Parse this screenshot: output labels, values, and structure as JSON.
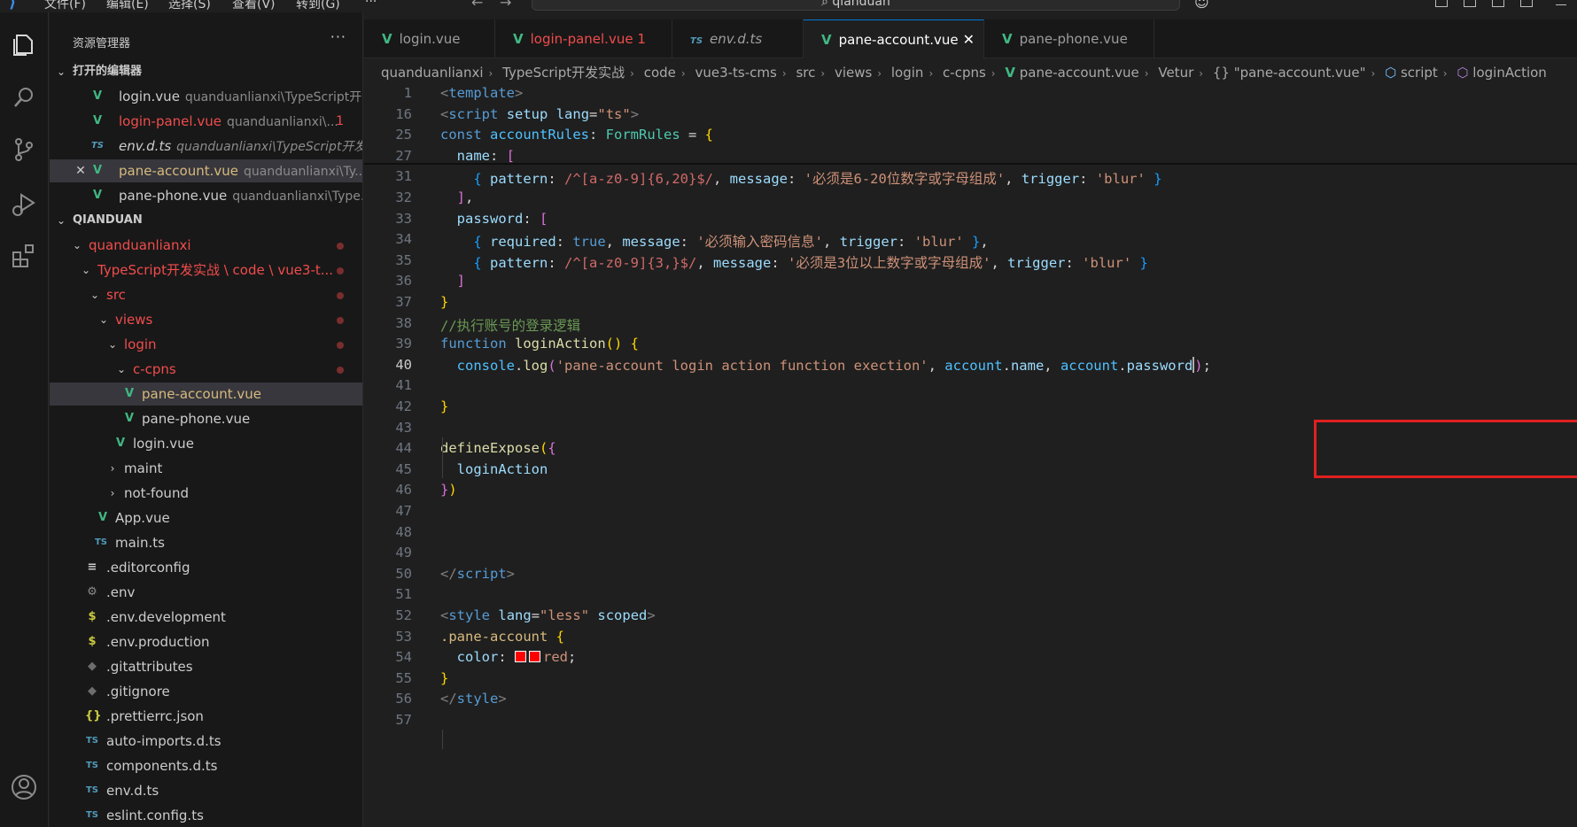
{
  "titlebar": {
    "menu": [
      "文件(F)",
      "编辑(E)",
      "选择(S)",
      "查看(V)",
      "转到(G)"
    ],
    "more": "···",
    "search_text": "qianduan"
  },
  "activity": {
    "icons": [
      "explorer-icon",
      "search-icon",
      "source-control-icon",
      "run-debug-icon",
      "extensions-icon",
      "account-icon"
    ]
  },
  "sidebar": {
    "title": "资源管理器",
    "more": "···",
    "open_editors_label": "打开的编辑器",
    "open_editors": [
      {
        "name": "login.vue",
        "path": "quanduanlianxi\\TypeScript开...",
        "icon": "vue"
      },
      {
        "name": "login-panel.vue",
        "path": "quanduanlianxi\\...",
        "icon": "vue",
        "badge": "1"
      },
      {
        "name": "env.d.ts",
        "path": "quanduanlianxi\\TypeScript开发...",
        "icon": "ts"
      },
      {
        "name": "pane-account.vue",
        "path": "quanduanlianxi\\Ty...",
        "icon": "vue",
        "close": "✕"
      },
      {
        "name": "pane-phone.vue",
        "path": "quanduanlianxi\\Type...",
        "icon": "vue"
      }
    ],
    "workspace_label": "QIANDUAN",
    "tree": [
      {
        "name": "quanduanlianxi",
        "type": "folder"
      },
      {
        "name": "TypeScript开发实战 \\ code \\ vue3-t...",
        "type": "folder"
      },
      {
        "name": "src",
        "type": "folder"
      },
      {
        "name": "views",
        "type": "folder"
      },
      {
        "name": "login",
        "type": "folder"
      },
      {
        "name": "c-cpns",
        "type": "folder"
      },
      {
        "name": "pane-account.vue",
        "type": "vue"
      },
      {
        "name": "pane-phone.vue",
        "type": "vue"
      },
      {
        "name": "login.vue",
        "type": "vue"
      },
      {
        "name": "maint",
        "type": "folder-closed"
      },
      {
        "name": "not-found",
        "type": "folder-closed"
      },
      {
        "name": "App.vue",
        "type": "vue"
      },
      {
        "name": "main.ts",
        "type": "ts"
      },
      {
        "name": ".editorconfig",
        "type": "lines"
      },
      {
        "name": ".env",
        "type": "gear"
      },
      {
        "name": ".env.development",
        "type": "dollar"
      },
      {
        "name": ".env.production",
        "type": "dollar"
      },
      {
        "name": ".gitattributes",
        "type": "git"
      },
      {
        "name": ".gitignore",
        "type": "git"
      },
      {
        "name": ".prettierrc.json",
        "type": "braces"
      },
      {
        "name": "auto-imports.d.ts",
        "type": "ts"
      },
      {
        "name": "components.d.ts",
        "type": "ts"
      },
      {
        "name": "env.d.ts",
        "type": "ts"
      },
      {
        "name": "eslint.config.ts",
        "type": "ts"
      }
    ]
  },
  "tabs": [
    {
      "label": "login.vue",
      "icon": "vue"
    },
    {
      "label": "login-panel.vue",
      "badge": "1",
      "icon": "vue"
    },
    {
      "label": "env.d.ts",
      "icon": "ts"
    },
    {
      "label": "pane-account.vue",
      "icon": "vue",
      "active": true
    },
    {
      "label": "pane-phone.vue",
      "icon": "vue"
    }
  ],
  "tab_close": "✕",
  "breadcrumb": [
    "quanduanlianxi",
    "TypeScript开发实战",
    "code",
    "vue3-ts-cms",
    "src",
    "views",
    "login",
    "c-cpns",
    "pane-account.vue",
    "Vetur",
    "{} \"pane-account.vue\"",
    "script",
    "loginAction"
  ],
  "editor": {
    "current_line": "40",
    "lines": [
      {
        "n": "1",
        "html": "<span class='t'>&lt;</span><span class='tg'>template</span><span class='t'>&gt;</span>"
      },
      {
        "n": "16",
        "html": "<span class='t'>&lt;</span><span class='tg'>script</span> <span class='at'>setup</span> <span class='at'>lang</span>=<span class='s'>\"ts\"</span><span class='t'>&gt;</span>"
      },
      {
        "n": "25",
        "html": "<span class='k'>const</span> <span class='v'>accountRules</span>: <span class='ty'>FormRules</span> = <span class='br1'>{</span>"
      },
      {
        "n": "27",
        "html": "  <span class='p'>name</span>: <span class='br2'>[</span>"
      },
      {
        "n": "31",
        "html": "    <span class='br3'>{</span> <span class='p'>pattern</span>: <span class='rx'>/^[a-z0-9]{6,20}$/</span>, <span class='p'>message</span>: <span class='s'>'必须是6-20位数字或字母组成'</span>, <span class='p'>trigger</span>: <span class='s'>'blur'</span> <span class='br3'>}</span>"
      },
      {
        "n": "32",
        "html": "  <span class='br2'>]</span>,"
      },
      {
        "n": "33",
        "html": "  <span class='p'>password</span>: <span class='br2'>[</span>"
      },
      {
        "n": "34",
        "html": "    <span class='br3'>{</span> <span class='p'>required</span>: <span class='k'>true</span>, <span class='p'>message</span>: <span class='s'>'必须输入密码信息'</span>, <span class='p'>trigger</span>: <span class='s'>'blur'</span> <span class='br3'>}</span>,"
      },
      {
        "n": "35",
        "html": "    <span class='br3'>{</span> <span class='p'>pattern</span>: <span class='rx'>/^[a-z0-9]{3,}$/</span>, <span class='p'>message</span>: <span class='s'>'必须是3位以上数字或字母组成'</span>, <span class='p'>trigger</span>: <span class='s'>'blur'</span> <span class='br3'>}</span>"
      },
      {
        "n": "36",
        "html": "  <span class='br2'>]</span>"
      },
      {
        "n": "37",
        "html": "<span class='br1'>}</span>"
      },
      {
        "n": "38",
        "html": "<span class='c'>//执行账号的登录逻辑</span>"
      },
      {
        "n": "39",
        "html": "<span class='k'>function</span> <span class='f'>loginAction</span><span class='br1'>()</span> <span class='br1'>{</span>"
      },
      {
        "n": "40",
        "html": "  <span class='v'>console</span>.<span class='f'>log</span><span class='br2'>(</span><span class='s'>'pane-account login action function exection'</span>, <span class='v'>account</span>.<span class='p'>name</span>, <span class='v'>account</span>.<span class='p'>password</span><span class='cursor'></span><span class='br2'>)</span>;"
      },
      {
        "n": "41",
        "html": ""
      },
      {
        "n": "42",
        "html": "<span class='br1'>}</span>"
      },
      {
        "n": "43",
        "html": ""
      },
      {
        "n": "44",
        "html": "<span class='f'>defineExpose</span><span class='br1'>(</span><span class='br2'>{</span>"
      },
      {
        "n": "45",
        "html": "  <span class='p'>loginAction</span>"
      },
      {
        "n": "46",
        "html": "<span class='br2'>}</span><span class='br1'>)</span>"
      },
      {
        "n": "47",
        "html": ""
      },
      {
        "n": "48",
        "html": ""
      },
      {
        "n": "49",
        "html": ""
      },
      {
        "n": "50",
        "html": "<span class='t'>&lt;/</span><span class='tg'>script</span><span class='t'>&gt;</span>"
      },
      {
        "n": "51",
        "html": ""
      },
      {
        "n": "52",
        "html": "<span class='t'>&lt;</span><span class='tg'>style</span> <span class='at'>lang</span>=<span class='s'>\"less\"</span> <span class='at'>scoped</span><span class='t'>&gt;</span>"
      },
      {
        "n": "53",
        "html": "<span class='sel'>.pane-account</span> <span class='br1'>{</span>"
      },
      {
        "n": "54",
        "html": "  <span class='p'>color</span>: <span class='swatch'></span><span class='swatch'></span><span class='s'>red</span>;"
      },
      {
        "n": "55",
        "html": "<span class='br1'>}</span>"
      },
      {
        "n": "56",
        "html": "<span class='t'>&lt;/</span><span class='tg'>style</span><span class='t'>&gt;</span>"
      },
      {
        "n": "57",
        "html": ""
      }
    ]
  },
  "colors": {
    "vue": "#41b883",
    "ts": "#519aba",
    "accent": "#0078d4",
    "highlight_box": "#e02020"
  }
}
